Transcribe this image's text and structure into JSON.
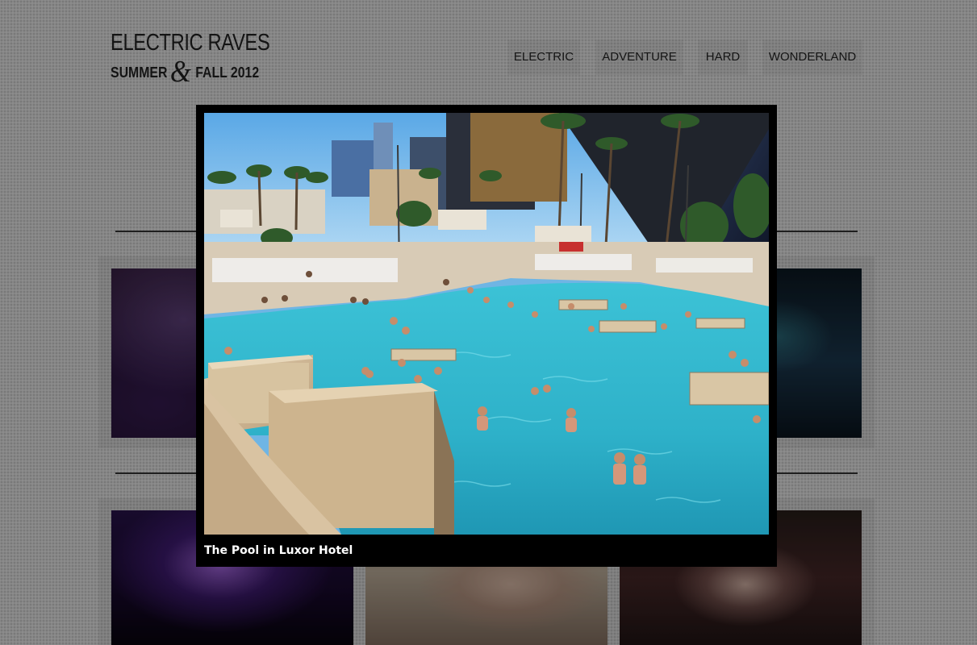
{
  "site": {
    "logo_line1": "ELECTRIC RAVES",
    "logo_word_a": "SUMMER",
    "logo_amp": "&",
    "logo_word_b": "FALL 2012"
  },
  "nav": {
    "items": [
      {
        "label": "ELECTRIC"
      },
      {
        "label": "ADVENTURE"
      },
      {
        "label": "HARD"
      },
      {
        "label": "WONDERLAND"
      }
    ]
  },
  "lightbox": {
    "caption": "The Pool in Luxor Hotel"
  },
  "colors": {
    "page_background": "#b3b3b3",
    "lightbox_frame": "#000000",
    "pool_water": "#31b3c8",
    "caption_text": "#ffffff"
  }
}
